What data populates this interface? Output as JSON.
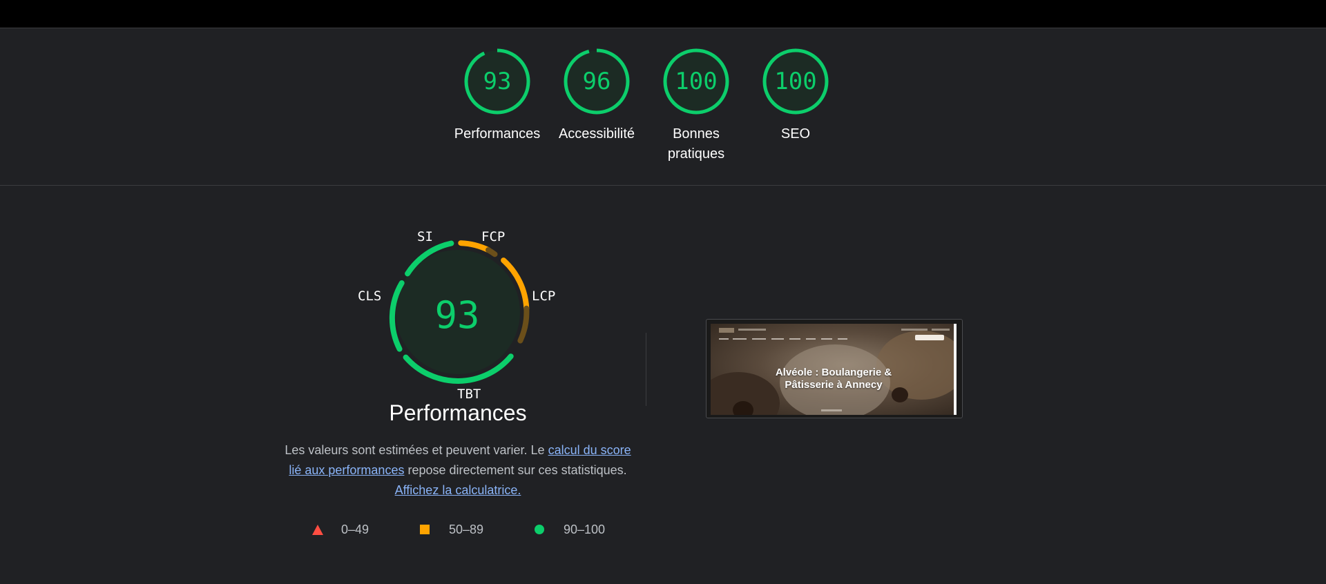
{
  "summary": {
    "gauges": [
      {
        "score": "93",
        "label": "Performances"
      },
      {
        "score": "96",
        "label": "Accessibilité"
      },
      {
        "score": "100",
        "label": "Bonnes pratiques"
      },
      {
        "score": "100",
        "label": "SEO"
      }
    ]
  },
  "performance": {
    "score": "93",
    "title": "Performances",
    "metrics": {
      "si": "SI",
      "fcp": "FCP",
      "lcp": "LCP",
      "tbt": "TBT",
      "cls": "CLS"
    },
    "description": {
      "part1": "Les valeurs sont estimées et peuvent varier. Le ",
      "link1": "calcul du score lié aux performances",
      "part2": " repose directement sur ces statistiques. ",
      "link2": "Affichez la calculatrice."
    },
    "legend": [
      {
        "range": "0–49",
        "shape": "triangle",
        "color": "#ff4e42"
      },
      {
        "range": "50–89",
        "shape": "square",
        "color": "#ffa400"
      },
      {
        "range": "90–100",
        "shape": "circle",
        "color": "#0cce6b"
      }
    ]
  },
  "screenshot": {
    "headline": "Alvéole : Boulangerie & Pâtisserie à Annecy"
  },
  "colors": {
    "pass": "#0cce6b",
    "average": "#ffa400",
    "fail": "#ff4e42",
    "background": "#202124",
    "link": "#8ab4f8"
  }
}
